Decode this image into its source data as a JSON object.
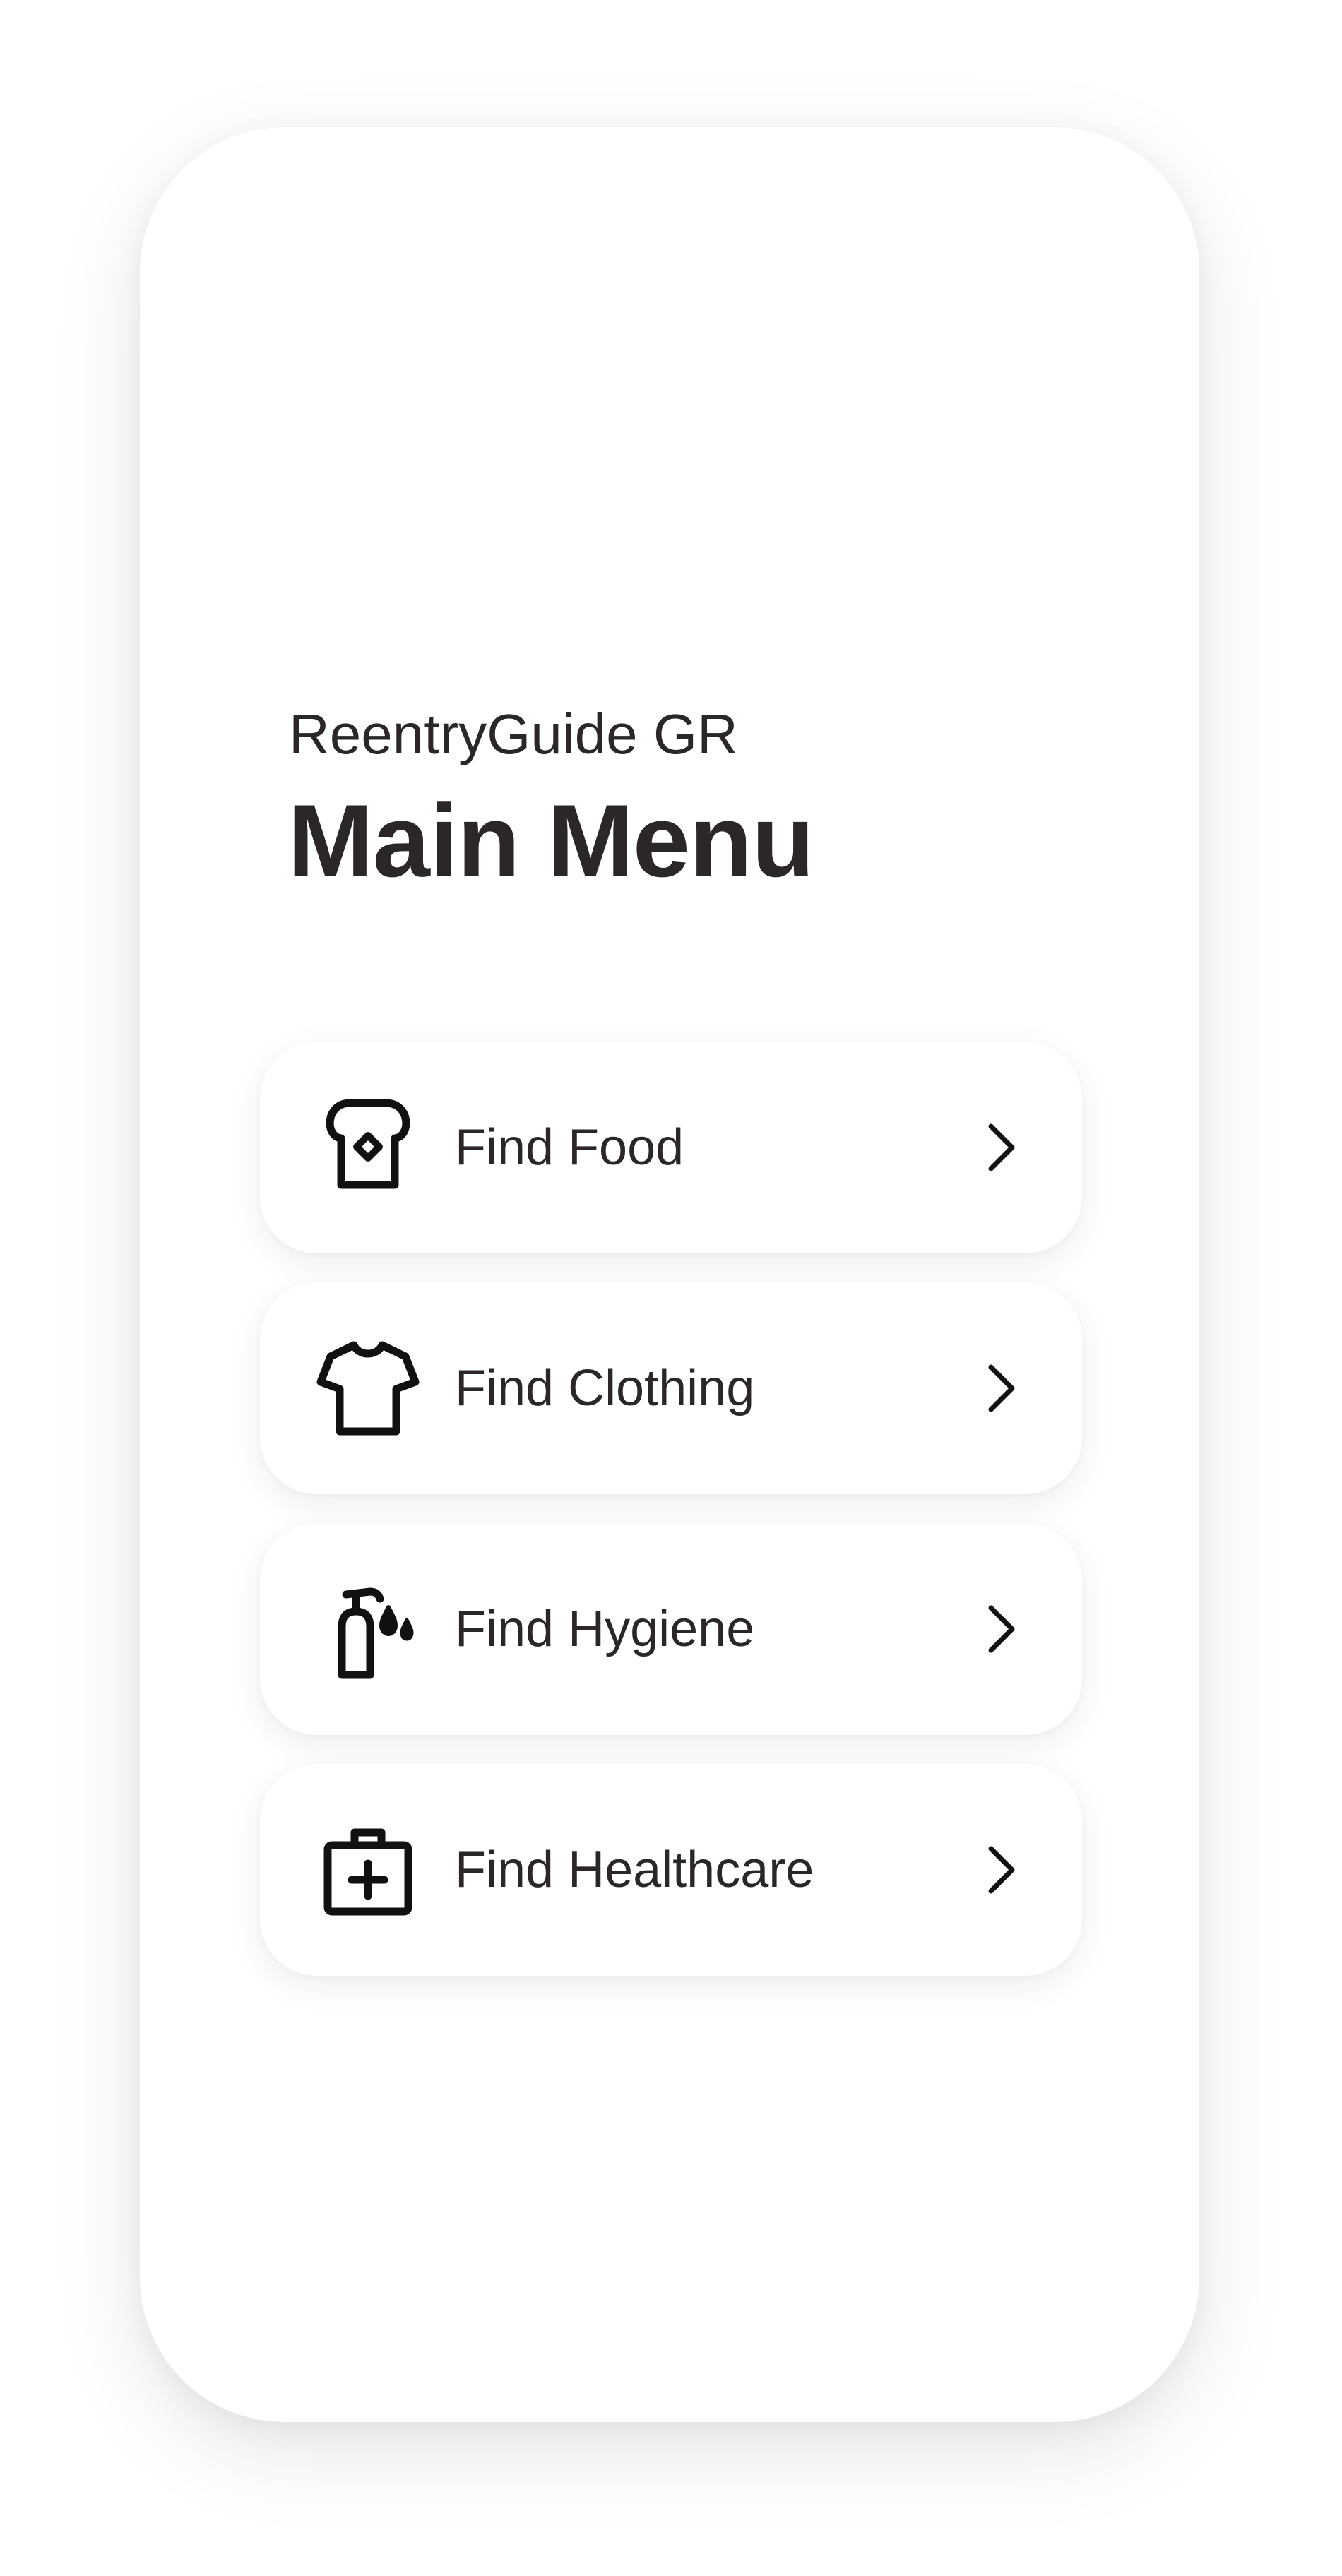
{
  "header": {
    "app_name": "ReentryGuide GR",
    "title": "Main Menu"
  },
  "menu": {
    "items": [
      {
        "label": "Find Food",
        "icon": "bread-icon"
      },
      {
        "label": "Find Clothing",
        "icon": "shirt-icon"
      },
      {
        "label": "Find Hygiene",
        "icon": "soap-dispenser-icon"
      },
      {
        "label": "Find Healthcare",
        "icon": "first-aid-kit-icon"
      }
    ],
    "trailing_icon": "chevron-right-icon"
  },
  "colors": {
    "text": "#2b2727",
    "background": "#ffffff",
    "card": "#ffffff"
  }
}
